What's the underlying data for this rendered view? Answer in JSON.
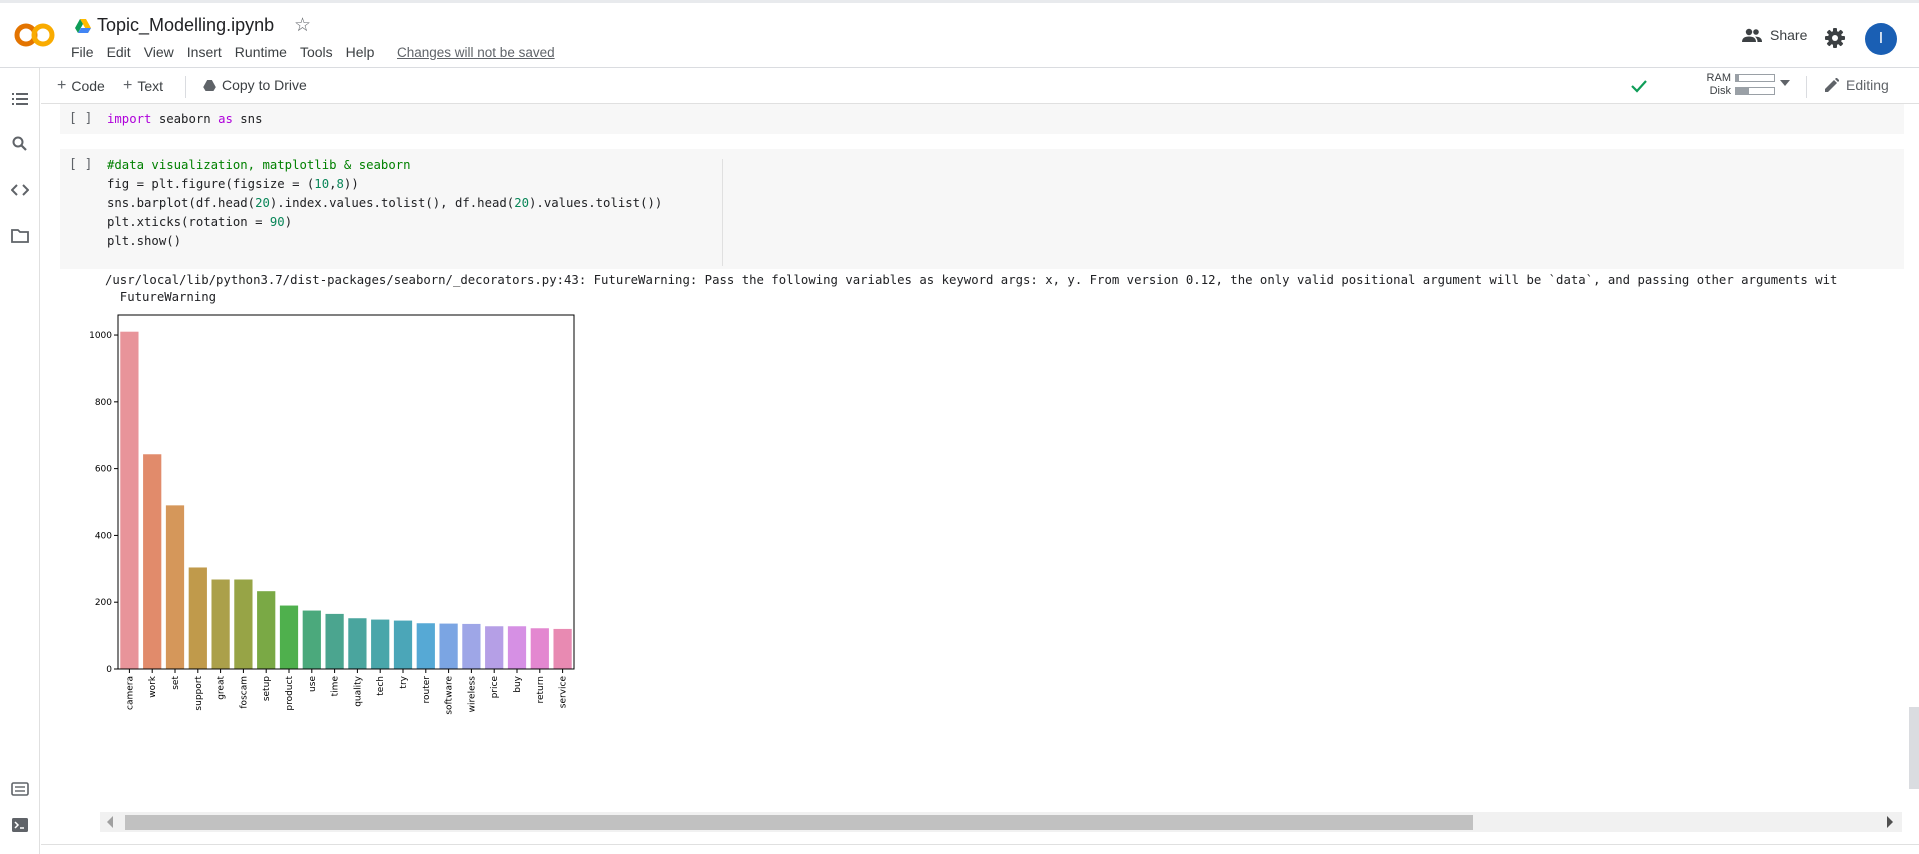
{
  "app": {
    "notebook_title": "Topic_Modelling.ipynb",
    "menu": [
      "File",
      "Edit",
      "View",
      "Insert",
      "Runtime",
      "Tools",
      "Help"
    ],
    "changes_notice": "Changes will not be saved",
    "share_label": "Share",
    "avatar_initial": "I",
    "logo_text": "CO",
    "colors": {
      "accent": "#1a5fb4",
      "logo_orange": "#f9ab00",
      "logo_dark": "#e37400"
    }
  },
  "toolbar": {
    "code_label": "Code",
    "text_label": "Text",
    "copy_label": "Copy to Drive",
    "ram_label": "RAM",
    "disk_label": "Disk",
    "ram_usage": 0.08,
    "disk_usage": 0.35,
    "mode_label": "Editing"
  },
  "cells": [
    {
      "run": "[ ]",
      "lines": [
        [
          {
            "t": "import",
            "c": "kw"
          },
          {
            "t": " seaborn ",
            "c": ""
          },
          {
            "t": "as",
            "c": "kw"
          },
          {
            "t": " sns",
            "c": ""
          }
        ]
      ]
    },
    {
      "run": "[ ]",
      "lines": [
        [
          {
            "t": "#data visualization, matplotlib & seaborn",
            "c": "cm"
          }
        ],
        [
          {
            "t": "fig = plt.figure(figsize = (",
            "c": ""
          },
          {
            "t": "10",
            "c": "num"
          },
          {
            "t": ",",
            "c": ""
          },
          {
            "t": "8",
            "c": "num"
          },
          {
            "t": "))",
            "c": ""
          }
        ],
        [
          {
            "t": "sns.barplot(df.head(",
            "c": ""
          },
          {
            "t": "20",
            "c": "num"
          },
          {
            "t": ").index.values.tolist(), df.head(",
            "c": ""
          },
          {
            "t": "20",
            "c": "num"
          },
          {
            "t": ").values.tolist())",
            "c": ""
          }
        ],
        [
          {
            "t": "plt.xticks(rotation = ",
            "c": ""
          },
          {
            "t": "90",
            "c": "num"
          },
          {
            "t": ")",
            "c": ""
          }
        ],
        [
          {
            "t": "plt.show()",
            "c": ""
          }
        ]
      ]
    }
  ],
  "output": {
    "warning_line1": "/usr/local/lib/python3.7/dist-packages/seaborn/_decorators.py:43: FutureWarning: Pass the following variables as keyword args: x, y. From version 0.12, the only valid positional argument will be `data`, and passing other arguments wit",
    "warning_line2": "  FutureWarning"
  },
  "chart_data": {
    "type": "bar",
    "categories": [
      "camera",
      "work",
      "set",
      "support",
      "great",
      "foscam",
      "setup",
      "product",
      "use",
      "time",
      "quality",
      "tech",
      "try",
      "router",
      "software",
      "wireless",
      "price",
      "buy",
      "return",
      "service"
    ],
    "values": [
      1010,
      643,
      490,
      304,
      268,
      268,
      233,
      190,
      175,
      165,
      152,
      148,
      145,
      137,
      136,
      135,
      128,
      128,
      122,
      120
    ],
    "colors": [
      "#e8949a",
      "#e18b6b",
      "#d5975a",
      "#c09a4b",
      "#aba04a",
      "#97a446",
      "#7aa945",
      "#4fb04d",
      "#4ba97c",
      "#4ba58f",
      "#4aa59e",
      "#49a6aa",
      "#4ba6b8",
      "#56a9d5",
      "#7ba5e3",
      "#9ea6e7",
      "#b59fe6",
      "#d690e4",
      "#e387d0",
      "#e88ab2"
    ],
    "yticks": [
      0,
      200,
      400,
      600,
      800,
      1000
    ],
    "ylim": [
      0,
      1060
    ],
    "title": "",
    "xlabel": "",
    "ylabel": "",
    "grid": false
  }
}
